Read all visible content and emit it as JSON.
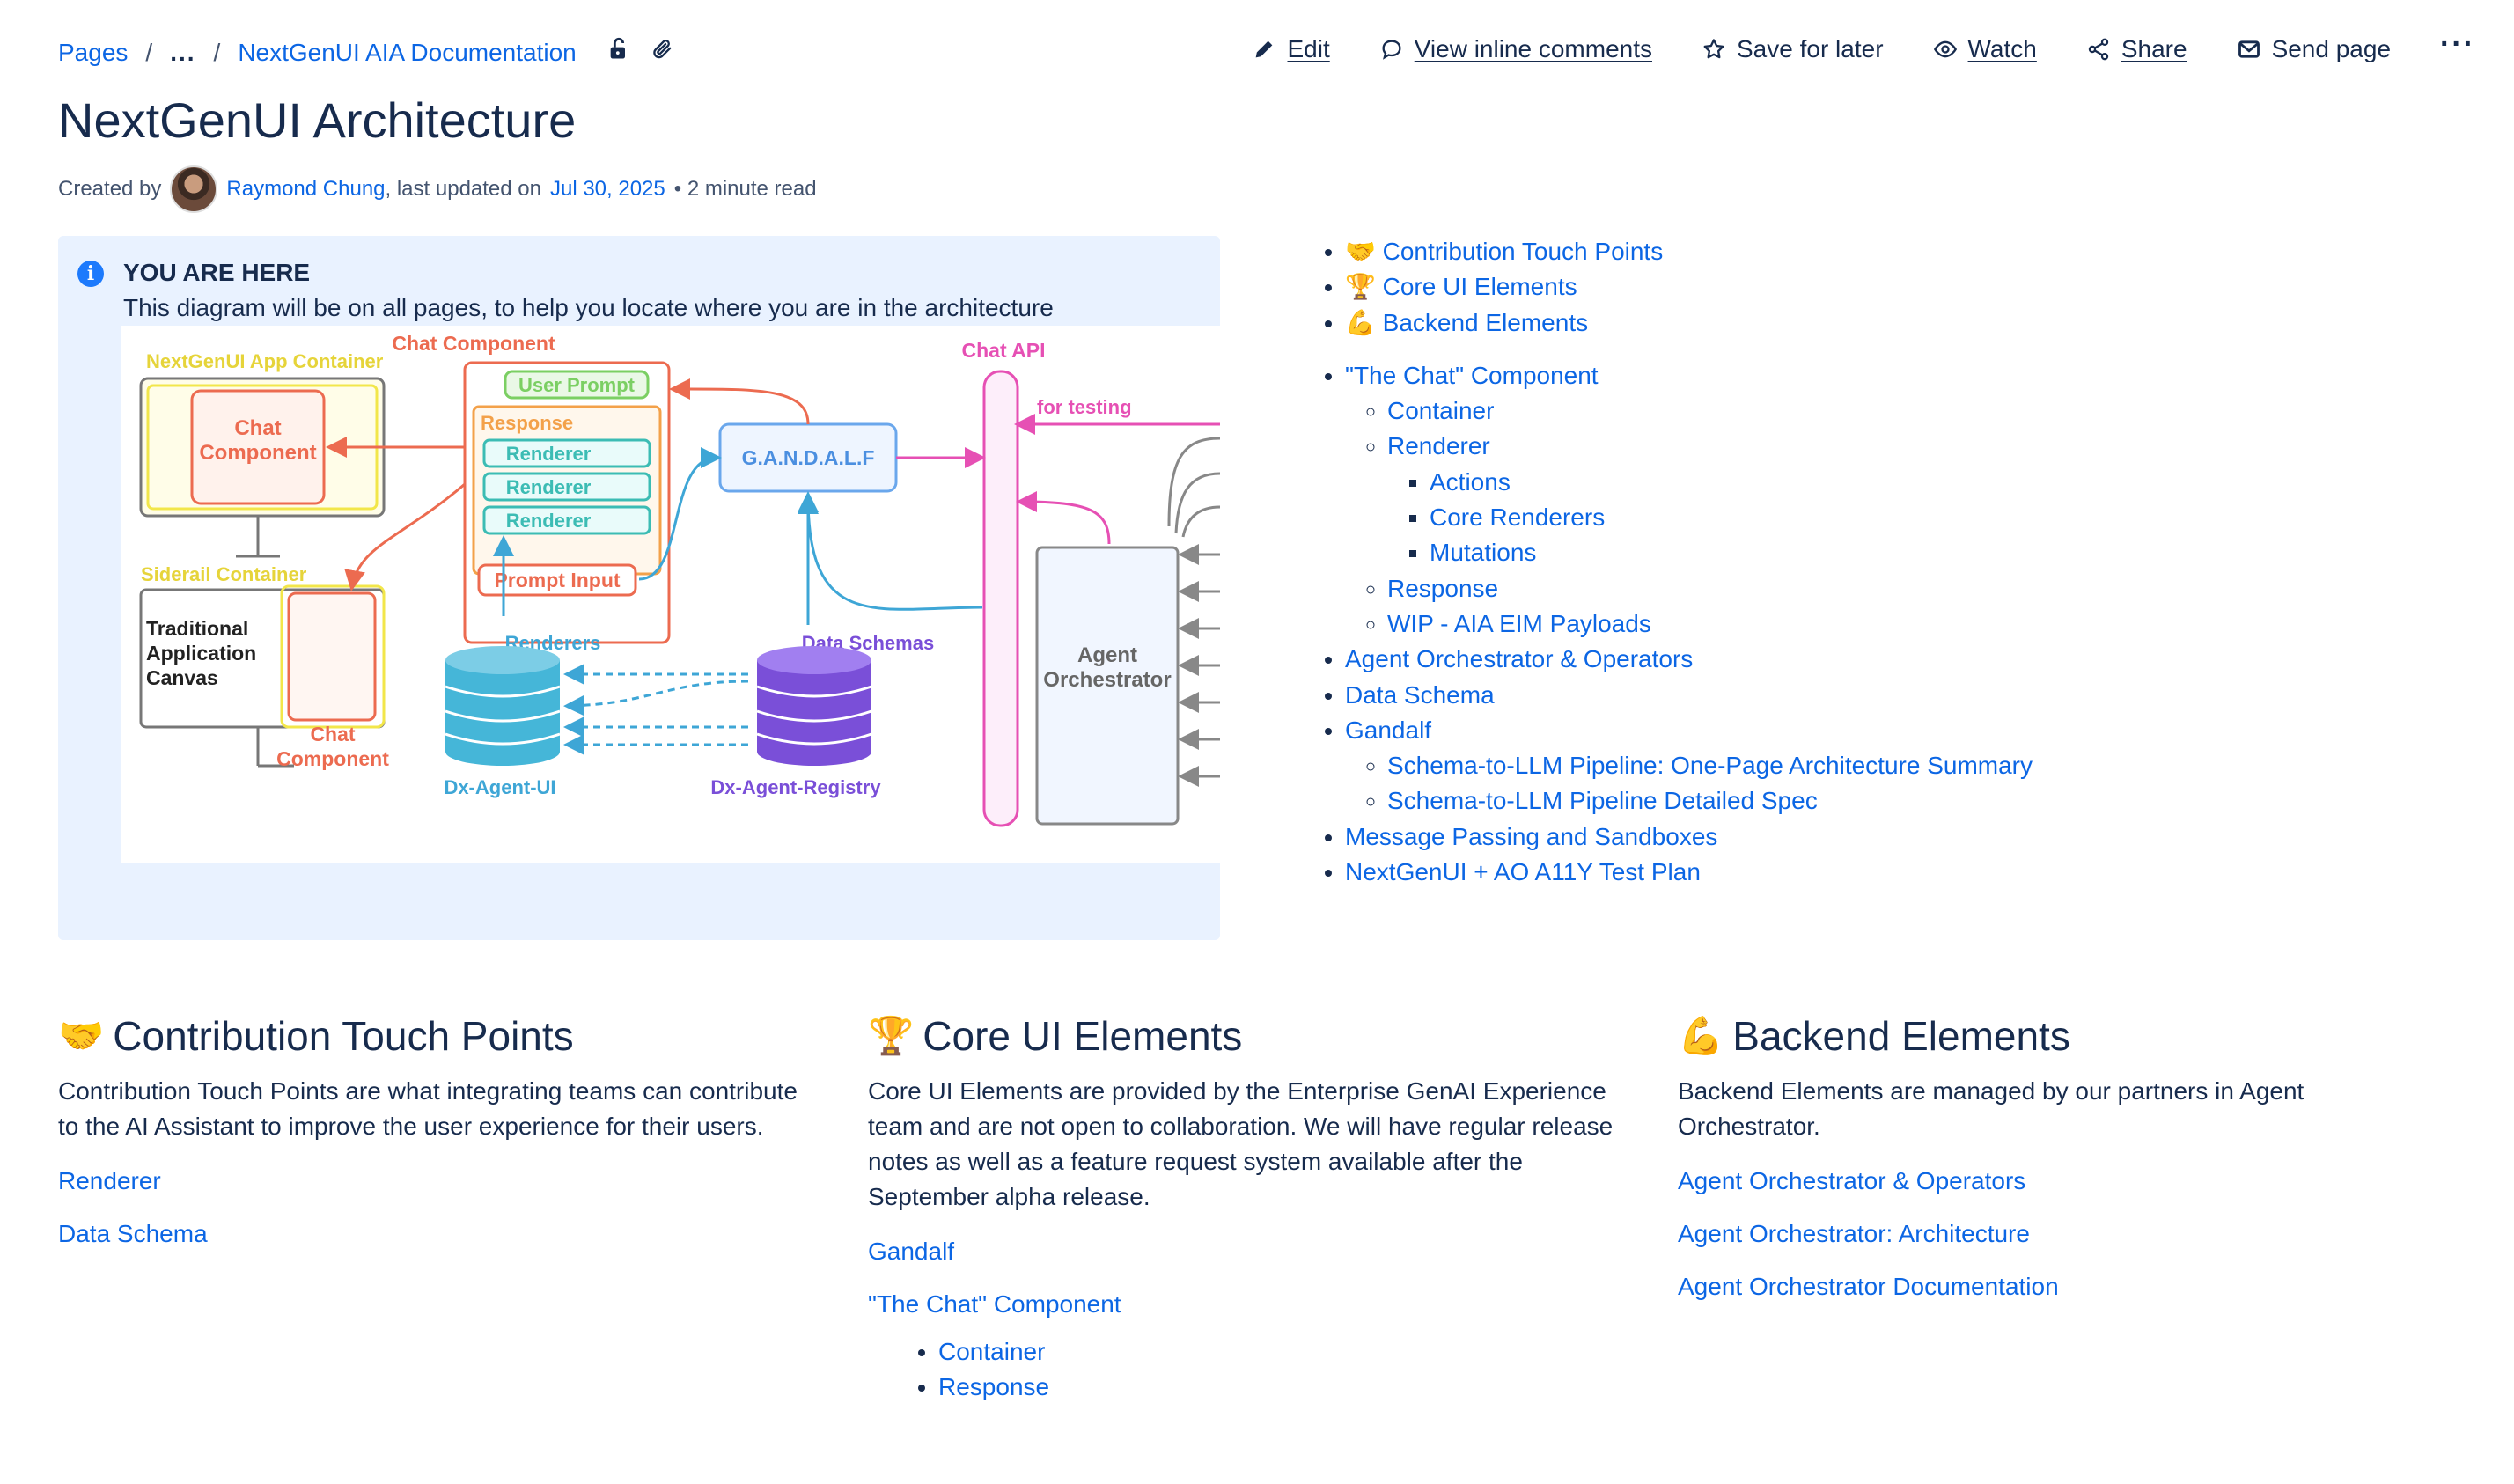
{
  "breadcrumb": {
    "pages": "Pages",
    "separator": "/",
    "ellipsis": "...",
    "current": "NextGenUI AIA Documentation"
  },
  "actions": {
    "edit": "Edit",
    "view_comments": "View inline comments",
    "save_later": "Save for later",
    "watch": "Watch",
    "share": "Share",
    "send_page": "Send page",
    "more": "···"
  },
  "title": "NextGenUI Architecture",
  "meta": {
    "created_by": "Created by",
    "author": "Raymond Chung",
    "updated_prefix": ", last updated on",
    "date": "Jul 30, 2025",
    "read_time": "• 2 minute read"
  },
  "panel": {
    "heading": "YOU ARE HERE",
    "text": "This diagram will be on all pages, to help you locate where you are in the architecture"
  },
  "diagram": {
    "app_container": "NextGenUI App Container",
    "chat_component": "Chat Component",
    "chat_comp_line1": "Chat",
    "chat_comp_line2": "Component",
    "user_prompt": "User Prompt",
    "response": "Response",
    "renderer": "Renderer",
    "prompt_input": "Prompt Input",
    "gandalf": "G.A.N.D.A.L.F",
    "chat_api": "Chat API",
    "for_testing": "for testing",
    "siderail": "Siderail Container",
    "traditional_1": "Traditional",
    "traditional_2": "Application",
    "traditional_3": "Canvas",
    "renderers": "Renderers",
    "data_schemas": "Data Schemas",
    "agent_1": "Agent",
    "agent_2": "Orchestrator",
    "dx_agent_ui": "Dx-Agent-UI",
    "dx_agent_registry": "Dx-Agent-Registry"
  },
  "toc": {
    "top": [
      "🤝 Contribution Touch Points",
      "🏆 Core UI Elements",
      "💪 Backend Elements"
    ],
    "chat": "\"The Chat\" Component",
    "container": "Container",
    "renderer": "Renderer",
    "actions": "Actions",
    "core_renderers": "Core Renderers",
    "mutations": "Mutations",
    "response": "Response",
    "wip": "WIP - AIA EIM Payloads",
    "agent_orch": "Agent Orchestrator & Operators",
    "data_schema": "Data Schema",
    "gandalf": "Gandalf",
    "schema_summary": "Schema-to-LLM Pipeline: One-Page Architecture Summary",
    "schema_spec": "Schema-to-LLM Pipeline Detailed Spec",
    "message_passing": "Message Passing and Sandboxes",
    "test_plan": "NextGenUI + AO A11Y Test Plan"
  },
  "sections": {
    "contribution": {
      "emoji": "🤝",
      "heading": "Contribution Touch Points",
      "body": "Contribution Touch Points are what integrating teams can contribute to the AI Assistant to improve the user experience for their users.",
      "links": [
        "Renderer",
        "Data Schema"
      ]
    },
    "core_ui": {
      "emoji": "🏆",
      "heading": "Core UI Elements",
      "body": "Core UI Elements are provided by the Enterprise GenAI Experience team and are not open to collaboration. We will have regular release notes as well as a feature request system available after the September alpha release.",
      "links": [
        "Gandalf",
        "\"The Chat\" Component"
      ],
      "sub": [
        "Container",
        "Response"
      ]
    },
    "backend": {
      "emoji": "💪",
      "heading": "Backend Elements",
      "body": "Backend Elements are managed by our partners in Agent Orchestrator.",
      "links": [
        "Agent Orchestrator & Operators",
        "Agent Orchestrator: Architecture",
        "Agent Orchestrator Documentation"
      ]
    }
  }
}
